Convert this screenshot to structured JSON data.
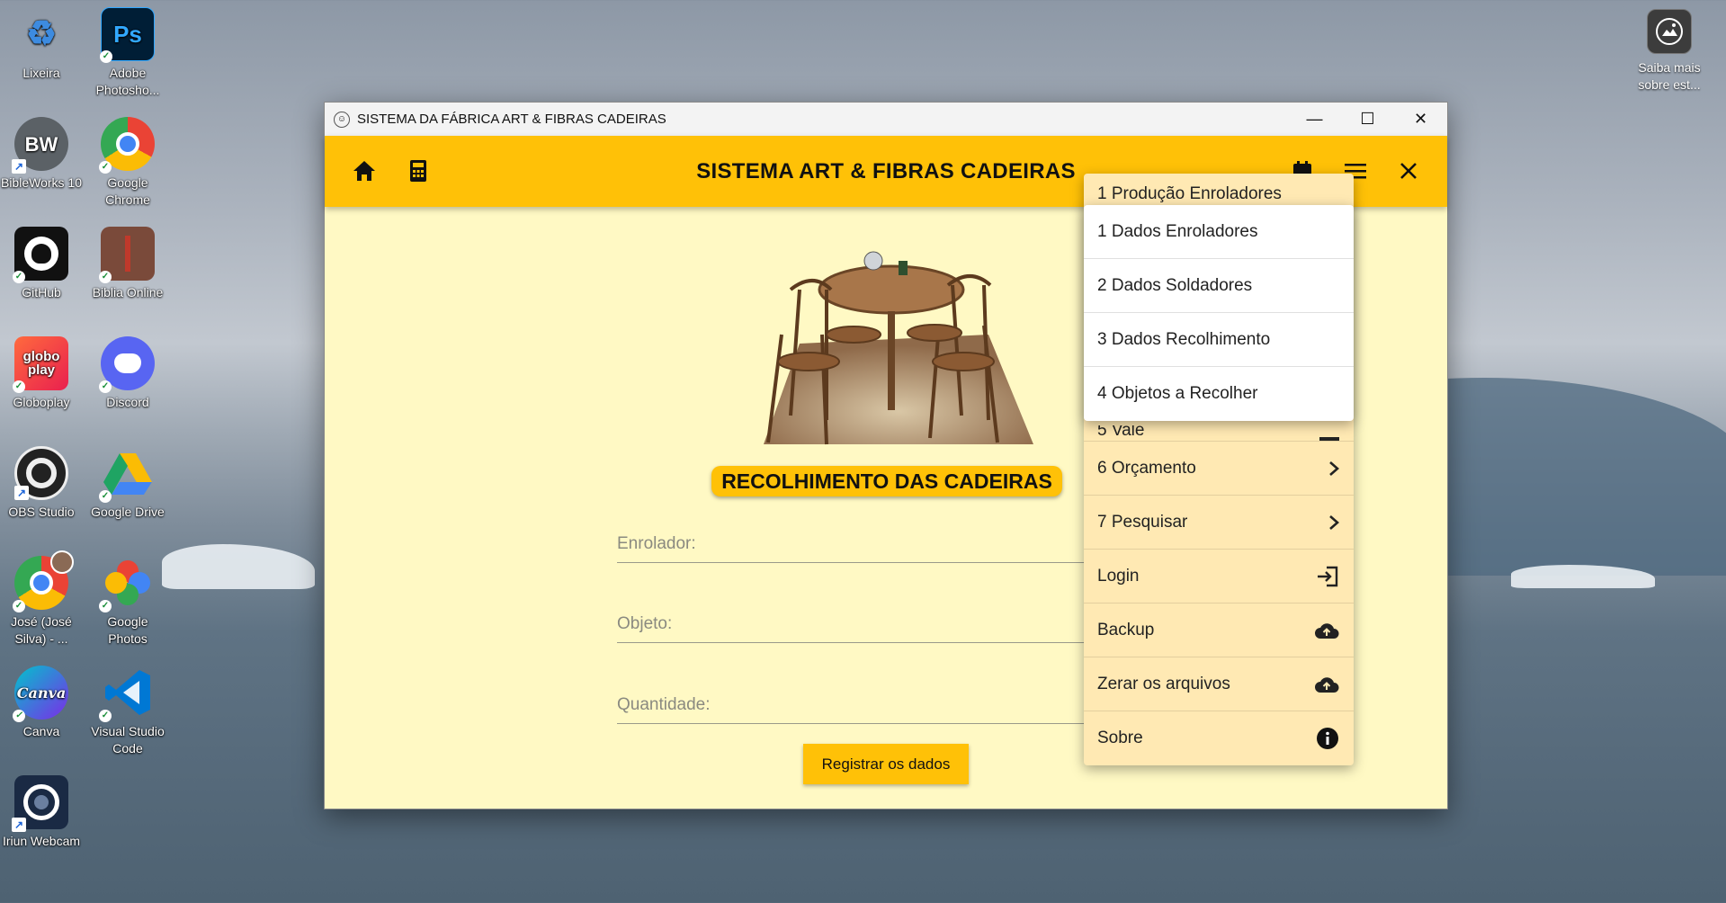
{
  "desktop": {
    "icons": [
      {
        "label": "Lixeira",
        "glyph": "♻",
        "color": "#cfd8e4"
      },
      {
        "label": "Adobe Photosho...",
        "glyph": "Ps",
        "color": "#001e36"
      },
      {
        "label": "BibleWorks 10",
        "glyph": "BW",
        "color": "#555b60"
      },
      {
        "label": "Google Chrome",
        "glyph": "",
        "color": "#2a7de1"
      },
      {
        "label": "GitHub",
        "glyph": "",
        "color": "#111111"
      },
      {
        "label": "Biblia Online",
        "glyph": "",
        "color": "#7a4a3a"
      },
      {
        "label": "Globoplay",
        "glyph": "globo play",
        "color": "#f2463a"
      },
      {
        "label": "Discord",
        "glyph": "",
        "color": "#5865f2"
      },
      {
        "label": "OBS Studio",
        "glyph": "",
        "color": "#222222"
      },
      {
        "label": "Google Drive",
        "glyph": "▲",
        "color": "transparent"
      },
      {
        "label": "José (José Silva) - ...",
        "glyph": "",
        "color": "#2a7de1"
      },
      {
        "label": "Google Photos",
        "glyph": "✿",
        "color": "transparent"
      },
      {
        "label": "Canva",
        "glyph": "Canva",
        "color": "#7d2ae8"
      },
      {
        "label": "Visual Studio Code",
        "glyph": "⟩⟨",
        "color": "transparent"
      },
      {
        "label": "Iriun Webcam",
        "glyph": "",
        "color": "#1a2a44"
      }
    ],
    "spotlight_label": "Saiba mais sobre est..."
  },
  "window": {
    "title": "SISTEMA DA FÁBRICA ART & FIBRAS CADEIRAS",
    "controls": {
      "minimize": "—",
      "maximize": "☐",
      "close": "✕"
    }
  },
  "appbar": {
    "title": "SISTEMA ART & FIBRAS CADEIRAS",
    "icons": [
      "home-icon",
      "calculator-icon",
      "calendar-icon",
      "menu-icon",
      "close-icon"
    ]
  },
  "main": {
    "banner": "RECOLHIMENTO DAS CADEIRAS",
    "fields": [
      {
        "placeholder": "Enrolador:"
      },
      {
        "placeholder": "Objeto:"
      },
      {
        "placeholder": "Quantidade:"
      }
    ],
    "submit_label": "Registrar os dados"
  },
  "menu": {
    "items": [
      {
        "label": "1 Produção Enroladores",
        "icon": ""
      },
      {
        "label": "",
        "icon": ""
      },
      {
        "label": "",
        "icon": ""
      },
      {
        "label": "",
        "icon": ""
      },
      {
        "label": "5 Vale",
        "icon": "list-icon"
      },
      {
        "label": "6 Orçamento",
        "icon": "chevron-right-icon"
      },
      {
        "label": "7 Pesquisar",
        "icon": "chevron-right-icon"
      },
      {
        "label": "Login",
        "icon": "login-icon"
      },
      {
        "label": "Backup",
        "icon": "cloud-upload-icon"
      },
      {
        "label": "Zerar os arquivos",
        "icon": "cloud-upload-icon"
      },
      {
        "label": "Sobre",
        "icon": "info-icon"
      }
    ]
  },
  "submenu": {
    "items": [
      {
        "label": "1 Dados Enroladores"
      },
      {
        "label": "2 Dados Soldadores"
      },
      {
        "label": "3 Dados Recolhimento"
      },
      {
        "label": "4 Objetos a Recolher"
      }
    ]
  }
}
